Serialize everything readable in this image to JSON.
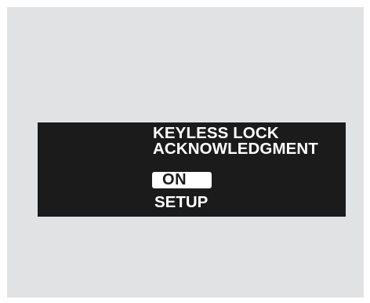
{
  "screen": {
    "title_line1": "KEYLESS LOCK",
    "title_line2": "ACKNOWLEDGMENT",
    "options": [
      {
        "label": "ON",
        "selected": true
      },
      {
        "label": "SETUP",
        "selected": false
      }
    ]
  },
  "colors": {
    "background_panel": "#e1e2e4",
    "display_background": "#1c1b1b",
    "text": "#ffffff",
    "highlight": "#ffffff"
  }
}
